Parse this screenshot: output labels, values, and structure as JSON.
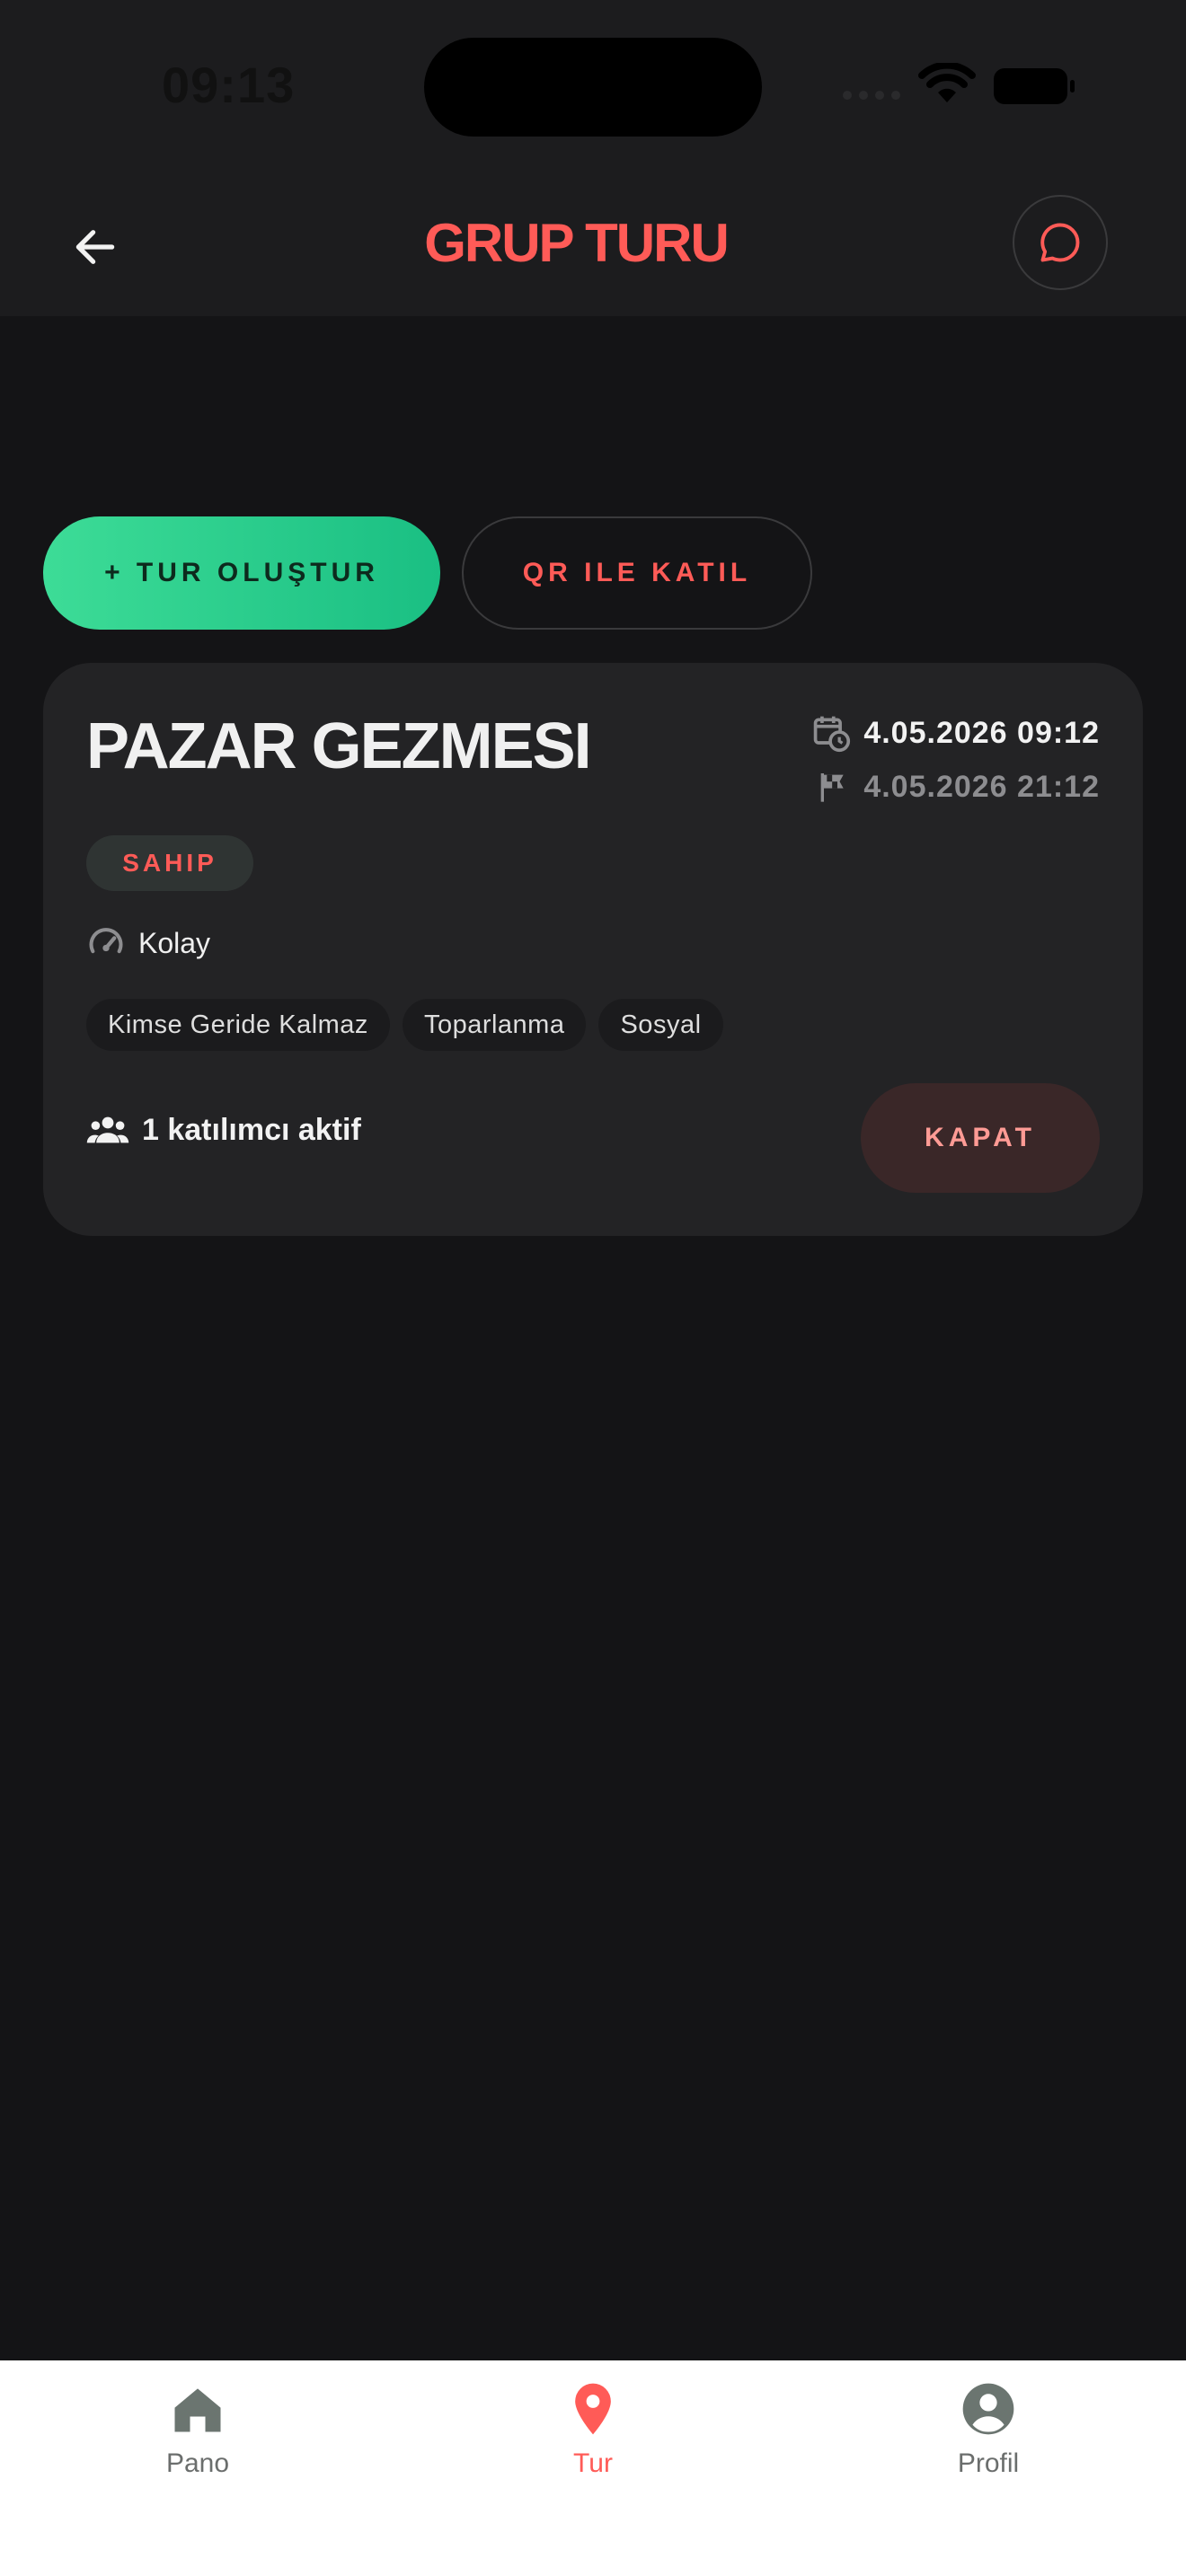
{
  "status_bar": {
    "time": "09:13"
  },
  "app_bar": {
    "title": "GRUP TURU"
  },
  "actions": {
    "create_label": "+ TUR OLUŞTUR",
    "join_qr_label": "QR ILE KATIL"
  },
  "tour": {
    "name": "PAZAR GEZMESI",
    "start": "4.05.2026 09:12",
    "end": "4.05.2026 21:12",
    "role_badge": "SAHIP",
    "difficulty": "Kolay",
    "tags": [
      "Kimse Geride Kalmaz",
      "Toparlanma",
      "Sosyal"
    ],
    "participants": "1 katılımcı aktif",
    "close_label": "KAPAT"
  },
  "tabs": [
    {
      "label": "Pano",
      "icon": "home-icon",
      "active": false
    },
    {
      "label": "Tur",
      "icon": "location-pin-icon",
      "active": true
    },
    {
      "label": "Profil",
      "icon": "account-circle-icon",
      "active": false
    }
  ],
  "colors": {
    "accent": "#ff5b57",
    "create_gradient_start": "#3ddc97",
    "create_gradient_end": "#1abf83",
    "background": "#141416",
    "card": "#232325"
  }
}
